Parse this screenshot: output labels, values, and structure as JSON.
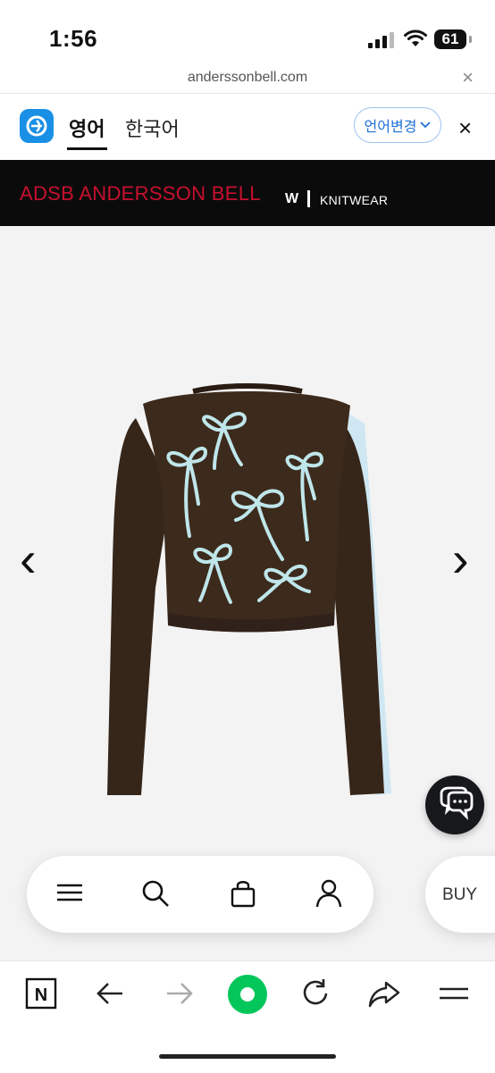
{
  "status_bar": {
    "time": "1:56",
    "battery": "61"
  },
  "url_bar": {
    "url": "anderssonbell.com",
    "close_glyph": "×"
  },
  "translate_bar": {
    "tab_active": "영어",
    "tab_inactive": "한국어",
    "change_language_label": "언어변경",
    "close_glyph": "×"
  },
  "brand_banner": {
    "brand_name": "ADSB  ANDERSSON BELL",
    "gender": "W",
    "category": "KNITWEAR",
    "colors": {
      "background": "#0b0b0c",
      "brand_red": "#c8102e"
    }
  },
  "product_viewer": {
    "prev_glyph": "‹",
    "next_glyph": "›",
    "image": "brown cropped knit cardigan with light blue bow embroidery",
    "colors": {
      "knit": "#3c2a1c",
      "bows": "#bfe6ea"
    }
  },
  "shop_nav": {
    "icons": [
      "menu-icon",
      "search-icon",
      "shopping-bag-icon",
      "account-icon"
    ],
    "buy_label": "BUY"
  },
  "browser_bar": {
    "icons": [
      "naver-n-icon",
      "back-icon",
      "forward-icon",
      "green-dot-home-icon",
      "reload-icon",
      "share-icon",
      "more-menu-icon"
    ],
    "n_label": "N",
    "colors": {
      "green": "#03c75a"
    }
  }
}
